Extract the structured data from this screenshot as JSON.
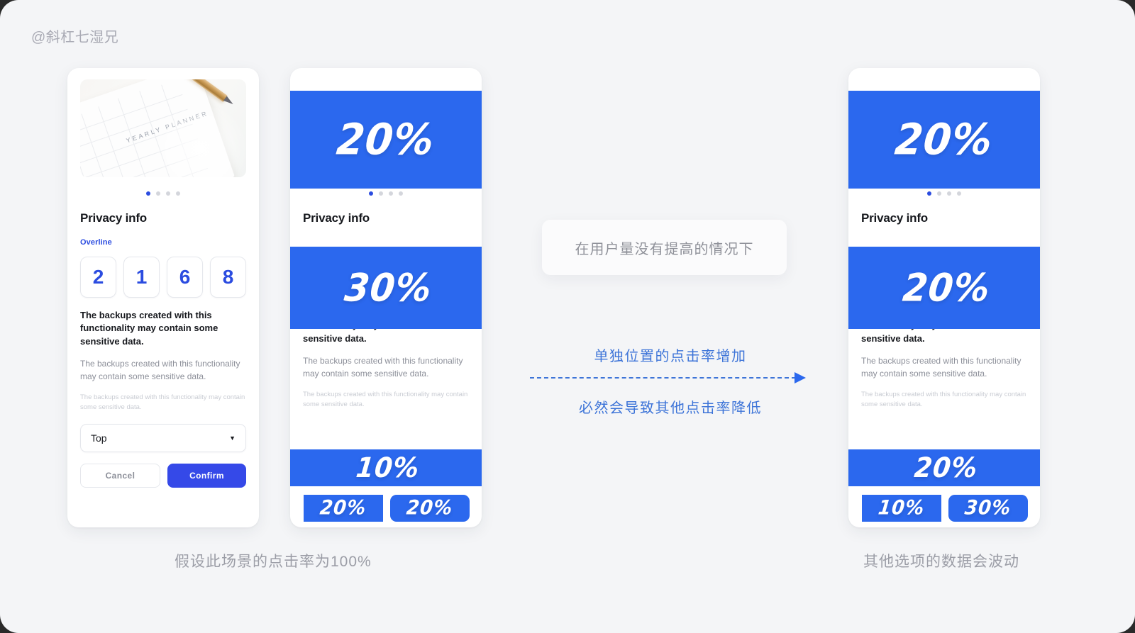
{
  "watermark": "@斜杠七湿兄",
  "theme": {
    "background": "#f4f5f7",
    "accent_blue": "#2B68EE",
    "button_blue": "#3549E8",
    "link_blue": "#2b4ce0",
    "annotation_blue": "#3d74d8",
    "muted_text": "#8c8f99"
  },
  "cards": [
    {
      "id": "card-original",
      "hero_type": "image",
      "hero_image_alt": "YEARLY PLANNER notebook with gold pen",
      "dots": {
        "count": 4,
        "active_index": 0
      },
      "title": "Privacy info",
      "overline": "Overline",
      "otp_digits": [
        "2",
        "1",
        "6",
        "8"
      ],
      "body_strong": "The backups created with this functionality may contain some sensitive data.",
      "body_mid": "The backups created with this functionality may contain some sensitive data.",
      "body_faint": "The backups created with this functionality may contain some sensitive data.",
      "select_value": "Top",
      "cancel_label": "Cancel",
      "confirm_label": "Confirm"
    },
    {
      "id": "card-middle",
      "hero_type": "percent",
      "hero_percent": "20%",
      "dots": {
        "count": 4,
        "active_index": 0
      },
      "title": "Privacy info",
      "mid_percent": "30%",
      "body_strong": "The backups created with this functionality may contain some sensitive data.",
      "body_mid": "The backups created with this functionality may contain some sensitive data.",
      "body_faint": "The backups created with this functionality may contain some sensitive data.",
      "select_percent": "10%",
      "cancel_percent": "20%",
      "confirm_percent": "20%"
    },
    {
      "id": "card-right",
      "hero_type": "percent",
      "hero_percent": "20%",
      "dots": {
        "count": 4,
        "active_index": 0
      },
      "title": "Privacy info",
      "mid_percent": "20%",
      "body_strong": "The backups created with this functionality may contain some sensitive data.",
      "body_mid": "The backups created with this functionality may contain some sensitive data.",
      "body_faint": "The backups created with this functionality may contain some sensitive data.",
      "select_percent": "20%",
      "cancel_percent": "10%",
      "confirm_percent": "30%"
    }
  ],
  "annotations": {
    "note_box": "在用户量没有提高的情况下",
    "arrow_top": "单独位置的点击率增加",
    "arrow_bottom": "必然会导致其他点击率降低"
  },
  "captions": {
    "left": "假设此场景的点击率为100%",
    "right": "其他选项的数据会波动"
  }
}
